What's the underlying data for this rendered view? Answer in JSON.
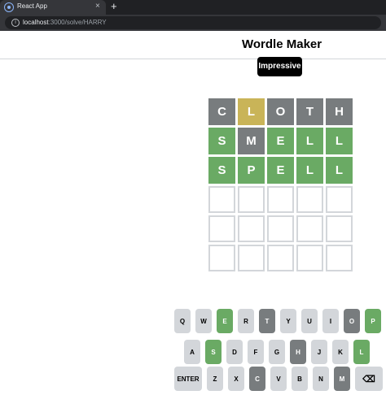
{
  "browser": {
    "tab_title": "React App",
    "tab_close": "×",
    "new_tab": "+",
    "url_host": "localhost",
    "url_path": ":3000/solve/HARRY",
    "info_glyph": "i"
  },
  "app": {
    "title": "Wordle Maker",
    "toast": "Impressive"
  },
  "board": {
    "rows": [
      [
        {
          "letter": "C",
          "state": "absent"
        },
        {
          "letter": "L",
          "state": "present"
        },
        {
          "letter": "O",
          "state": "absent"
        },
        {
          "letter": "T",
          "state": "absent"
        },
        {
          "letter": "H",
          "state": "absent"
        }
      ],
      [
        {
          "letter": "S",
          "state": "correct"
        },
        {
          "letter": "M",
          "state": "absent"
        },
        {
          "letter": "E",
          "state": "correct"
        },
        {
          "letter": "L",
          "state": "correct"
        },
        {
          "letter": "L",
          "state": "correct"
        }
      ],
      [
        {
          "letter": "S",
          "state": "correct"
        },
        {
          "letter": "P",
          "state": "correct"
        },
        {
          "letter": "E",
          "state": "correct"
        },
        {
          "letter": "L",
          "state": "correct"
        },
        {
          "letter": "L",
          "state": "correct"
        }
      ],
      [
        {
          "letter": "",
          "state": "empty"
        },
        {
          "letter": "",
          "state": "empty"
        },
        {
          "letter": "",
          "state": "empty"
        },
        {
          "letter": "",
          "state": "empty"
        },
        {
          "letter": "",
          "state": "empty"
        }
      ],
      [
        {
          "letter": "",
          "state": "empty"
        },
        {
          "letter": "",
          "state": "empty"
        },
        {
          "letter": "",
          "state": "empty"
        },
        {
          "letter": "",
          "state": "empty"
        },
        {
          "letter": "",
          "state": "empty"
        }
      ],
      [
        {
          "letter": "",
          "state": "empty"
        },
        {
          "letter": "",
          "state": "empty"
        },
        {
          "letter": "",
          "state": "empty"
        },
        {
          "letter": "",
          "state": "empty"
        },
        {
          "letter": "",
          "state": "empty"
        }
      ]
    ]
  },
  "keyboard": {
    "rows": [
      [
        {
          "label": "Q",
          "state": "unused"
        },
        {
          "label": "W",
          "state": "unused"
        },
        {
          "label": "E",
          "state": "correct"
        },
        {
          "label": "R",
          "state": "unused"
        },
        {
          "label": "T",
          "state": "absent"
        },
        {
          "label": "Y",
          "state": "unused"
        },
        {
          "label": "U",
          "state": "unused"
        },
        {
          "label": "I",
          "state": "unused"
        },
        {
          "label": "O",
          "state": "absent"
        },
        {
          "label": "P",
          "state": "correct"
        }
      ],
      [
        {
          "label": "A",
          "state": "unused"
        },
        {
          "label": "S",
          "state": "correct"
        },
        {
          "label": "D",
          "state": "unused"
        },
        {
          "label": "F",
          "state": "unused"
        },
        {
          "label": "G",
          "state": "unused"
        },
        {
          "label": "H",
          "state": "absent"
        },
        {
          "label": "J",
          "state": "unused"
        },
        {
          "label": "K",
          "state": "unused"
        },
        {
          "label": "L",
          "state": "correct"
        }
      ],
      [
        {
          "label": "ENTER",
          "state": "unused",
          "wide": true
        },
        {
          "label": "Z",
          "state": "unused"
        },
        {
          "label": "X",
          "state": "unused"
        },
        {
          "label": "C",
          "state": "absent"
        },
        {
          "label": "V",
          "state": "unused"
        },
        {
          "label": "B",
          "state": "unused"
        },
        {
          "label": "N",
          "state": "unused"
        },
        {
          "label": "M",
          "state": "absent"
        },
        {
          "label": "⌫",
          "state": "unused",
          "wide": true,
          "icon": "backspace-icon"
        }
      ]
    ]
  },
  "colors": {
    "correct": "#6aaa64",
    "present": "#c9b458",
    "absent": "#787c7e",
    "unused_key": "#d3d6da"
  }
}
